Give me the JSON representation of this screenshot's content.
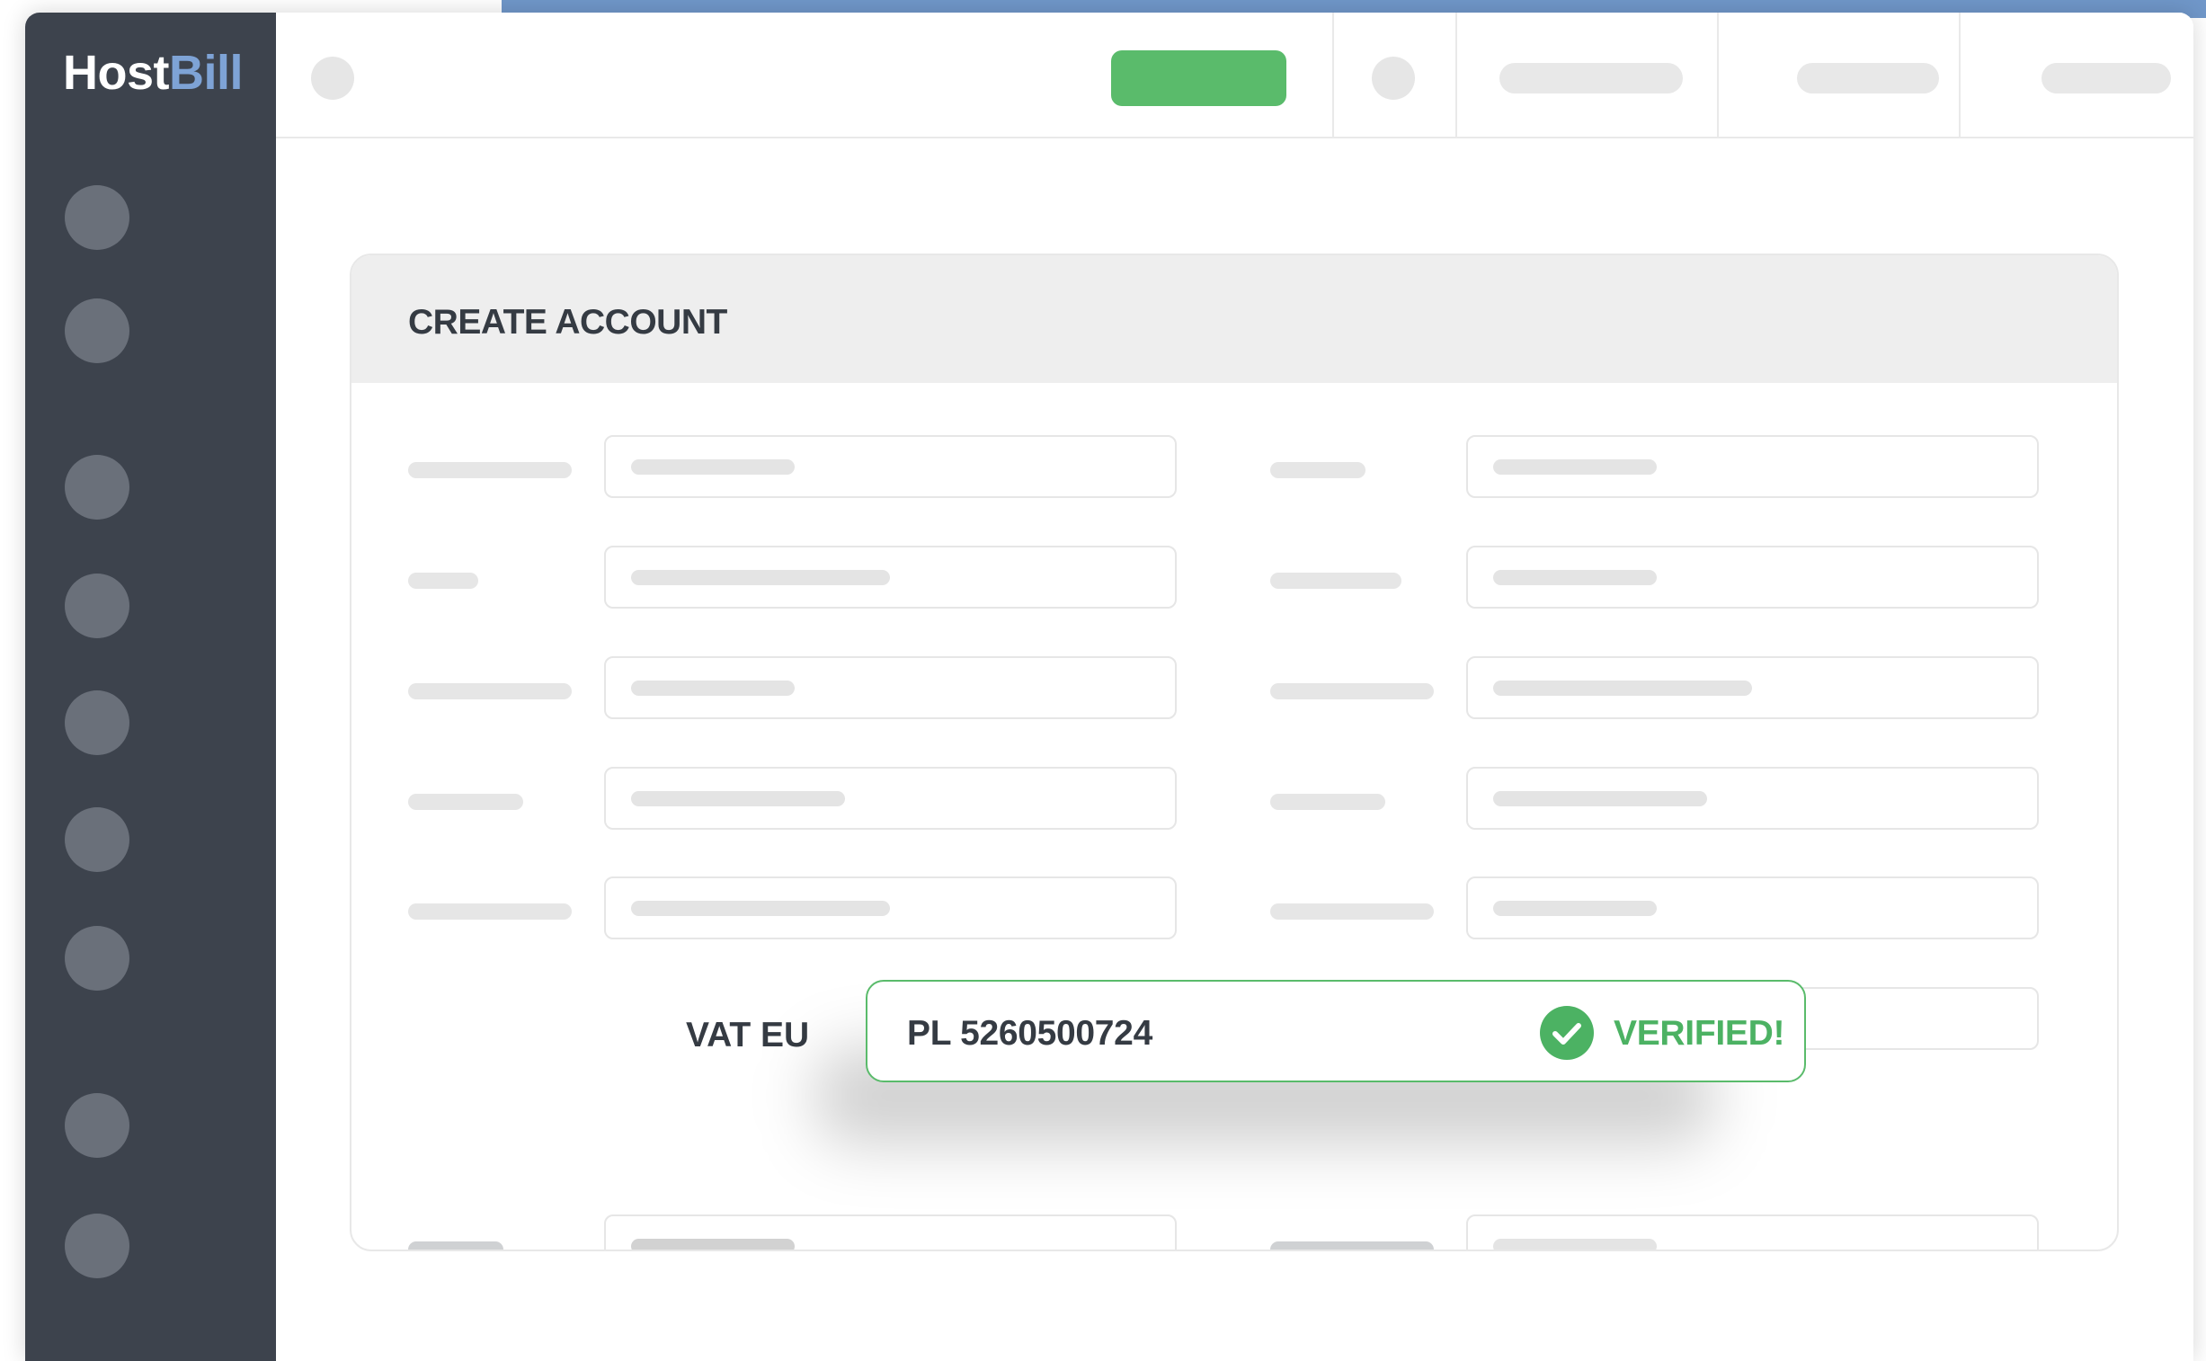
{
  "app": {
    "logo_part1": "Host",
    "logo_part2": "Bill"
  },
  "form": {
    "title": "CREATE ACCOUNT",
    "vat": {
      "label": "VAT EU",
      "value": "PL 5260500724",
      "status": "VERIFIED!"
    }
  },
  "colors": {
    "sidebar": "#3d434d",
    "accent_blue": "#7097c9",
    "success_green": "#4cb263",
    "primary_button": "#5abb6b"
  },
  "icons": {
    "verified": "check-circle-icon",
    "nav": "circle-placeholder-icon"
  }
}
